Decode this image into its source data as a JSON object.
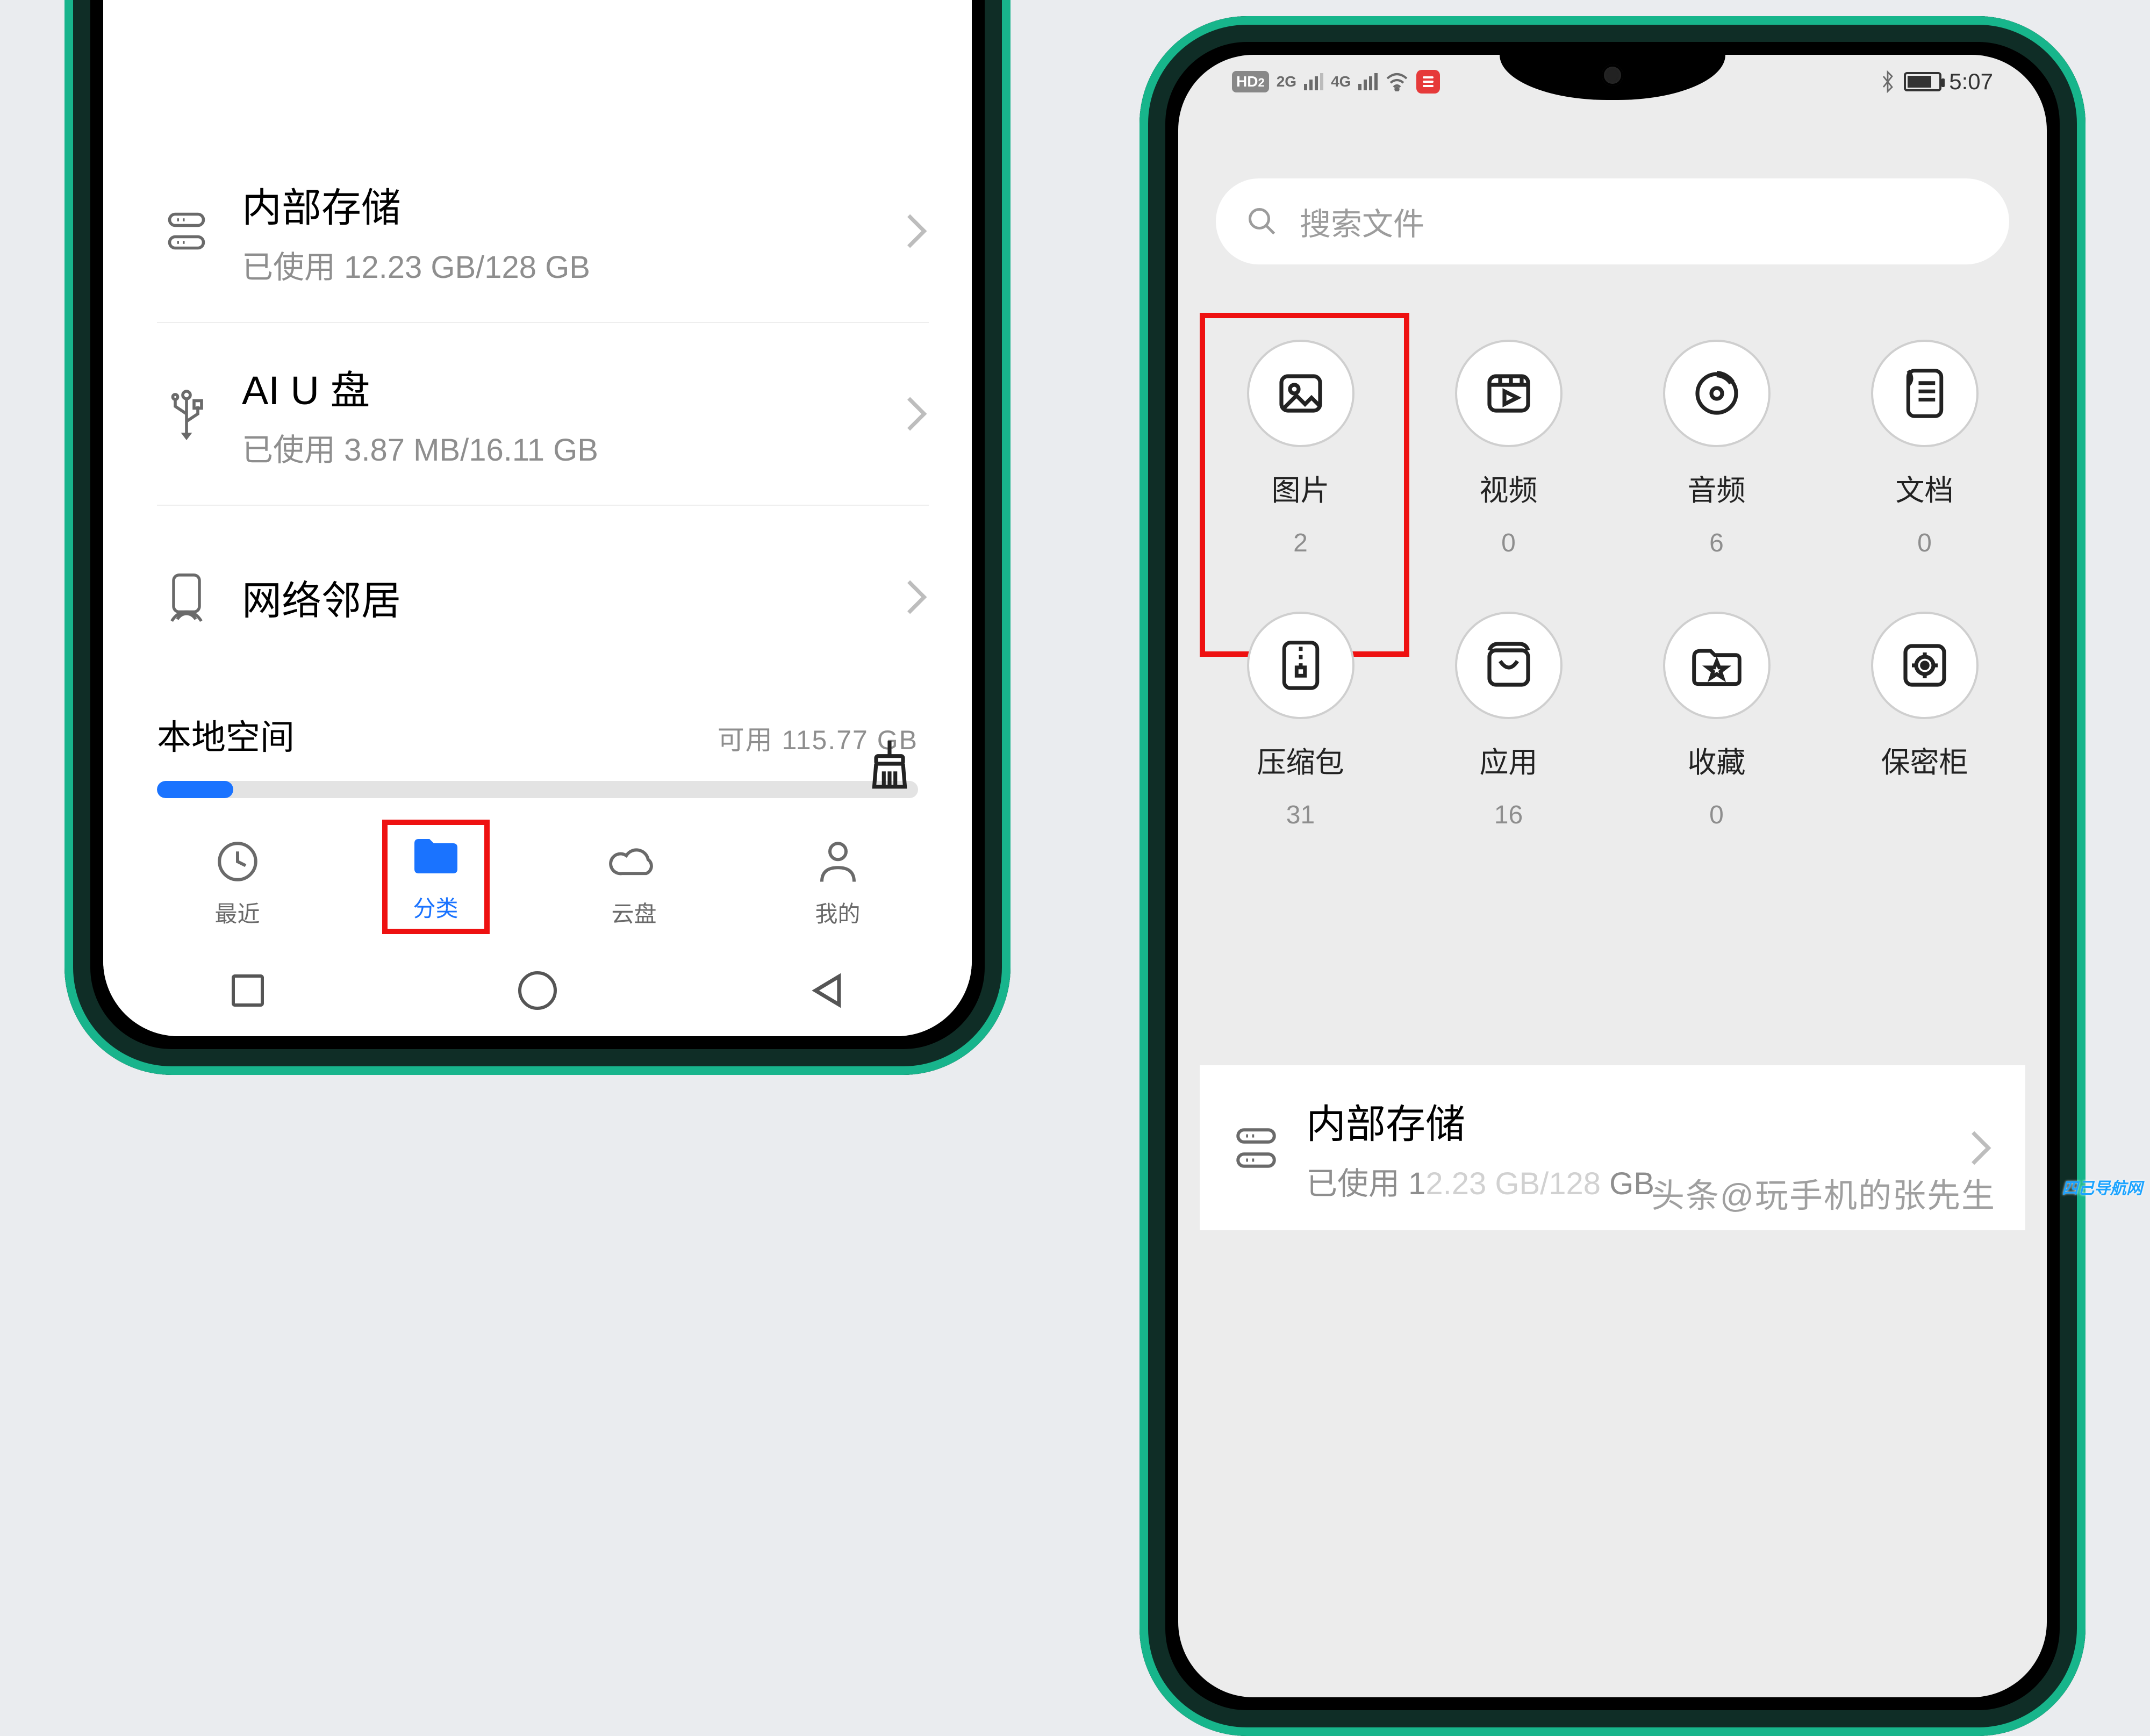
{
  "phone_left": {
    "storage_list": [
      {
        "title": "内部存储",
        "sub": "已使用 12.23 GB/128 GB"
      },
      {
        "title": "AI U 盘",
        "sub": "已使用 3.87 MB/16.11 GB"
      },
      {
        "title": "网络邻居",
        "sub": ""
      }
    ],
    "local_space": {
      "title": "本地空间",
      "avail": "可用 115.77 GB"
    },
    "tabs": [
      {
        "label": "最近"
      },
      {
        "label": "分类"
      },
      {
        "label": "云盘"
      },
      {
        "label": "我的"
      }
    ]
  },
  "phone_right": {
    "status": {
      "hd": "HD",
      "hd_badge_sub": "2",
      "sig_g": "2G",
      "sig_4g": "4G",
      "time": "5:07"
    },
    "search_placeholder": "搜索文件",
    "categories": [
      {
        "label": "图片",
        "count": "2"
      },
      {
        "label": "视频",
        "count": "0"
      },
      {
        "label": "音频",
        "count": "6"
      },
      {
        "label": "文档",
        "count": "0"
      },
      {
        "label": "压缩包",
        "count": "31"
      },
      {
        "label": "应用",
        "count": "16"
      },
      {
        "label": "收藏",
        "count": "0"
      },
      {
        "label": "保密柜",
        "count": ""
      }
    ],
    "storage": {
      "title": "内部存储",
      "sub_prefix": "已使用 1",
      "sub_suffix": " GB"
    }
  },
  "watermark": "头条@玩手机的张先生",
  "corner_tag": "四己导航网"
}
